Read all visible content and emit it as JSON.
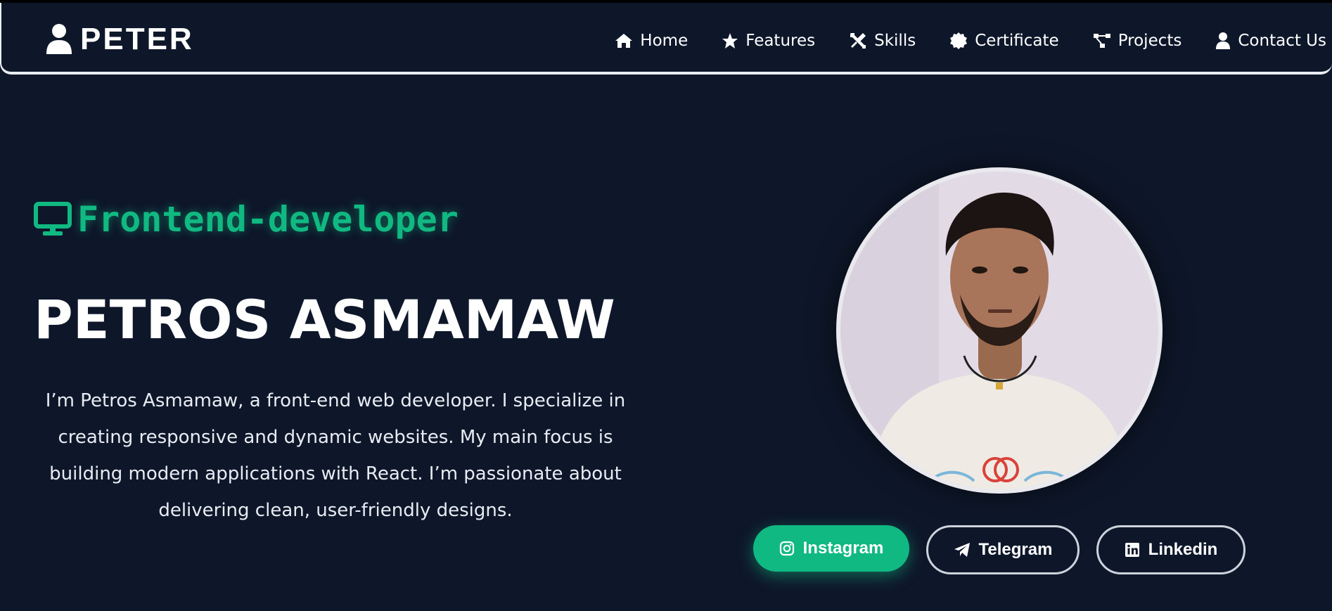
{
  "header": {
    "brand": "PETER",
    "brand_icon": "user-icon",
    "nav": [
      {
        "label": "Home",
        "icon": "home-icon"
      },
      {
        "label": "Features",
        "icon": "star-icon"
      },
      {
        "label": "Skills",
        "icon": "tools-icon"
      },
      {
        "label": "Certificate",
        "icon": "badge-icon"
      },
      {
        "label": "Projects",
        "icon": "project-diagram-icon"
      },
      {
        "label": "Contact Us",
        "icon": "user-icon"
      }
    ]
  },
  "hero": {
    "role": "Frontend-developer",
    "role_icon": "monitor-icon",
    "name": "PETROS ASMAMAW",
    "bio": "I’m Petros Asmamaw, a front-end web developer. I specialize in creating responsive and dynamic websites. My main focus is building modern applications with React. I’m passionate about delivering clean, user-friendly designs.",
    "avatar_alt": "profile-photo"
  },
  "socials": [
    {
      "label": "Instagram",
      "icon": "instagram-icon"
    },
    {
      "label": "Telegram",
      "icon": "telegram-icon"
    },
    {
      "label": "Linkedin",
      "icon": "linkedin-icon"
    }
  ],
  "colors": {
    "background": "#0e172a",
    "accent": "#10b981",
    "text": "#ffffff"
  }
}
